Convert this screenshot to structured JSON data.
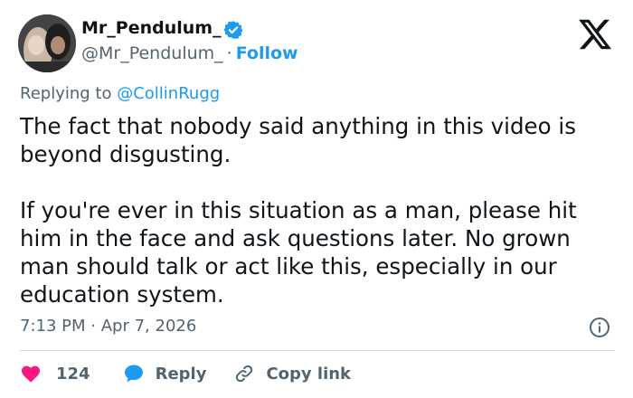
{
  "author": {
    "display_name": "Mr_Pendulum_",
    "handle": "@Mr_Pendulum_",
    "separator": "·",
    "follow_label": "Follow"
  },
  "reply_context": {
    "prefix": "Replying to",
    "target": "@CollinRugg"
  },
  "tweet": {
    "paragraph_1": "The fact that nobody said anything in this video is beyond disgusting.",
    "paragraph_2": "If you're ever in this situation as a man, please hit him in the face and ask questions later. No grown man should talk or act like this, especially in our education system."
  },
  "meta": {
    "time": "7:13 PM",
    "separator": "·",
    "date": "Apr 7, 2026"
  },
  "actions": {
    "like_count": "124",
    "reply_label": "Reply",
    "copy_link_label": "Copy link"
  },
  "colors": {
    "accent": "#1d9bf0",
    "like": "#f91880",
    "text": "#0f1419",
    "muted": "#536471"
  },
  "icons": [
    "verified-badge-icon",
    "x-logo-icon",
    "info-icon",
    "heart-icon",
    "reply-bubble-icon",
    "link-icon"
  ]
}
